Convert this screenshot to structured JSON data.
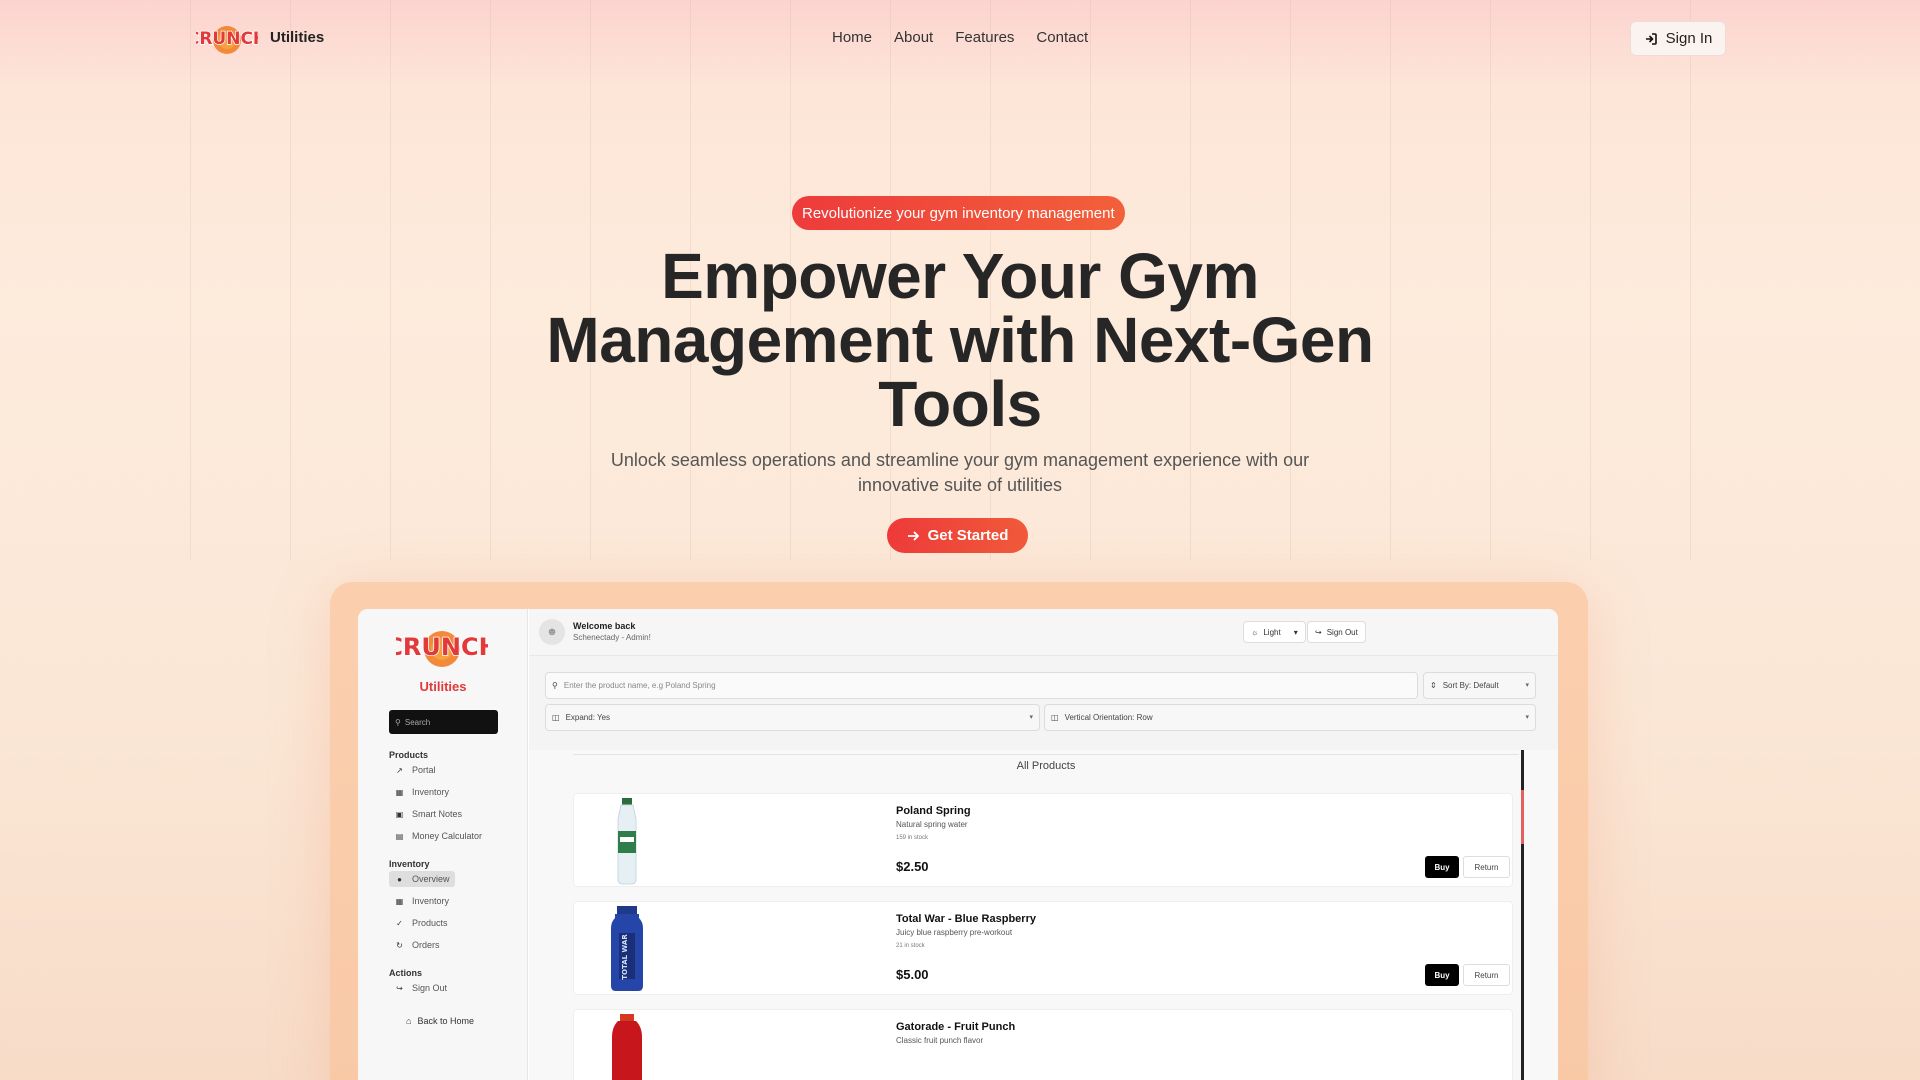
{
  "header": {
    "brand": "Utilities",
    "nav": [
      "Home",
      "About",
      "Features",
      "Contact"
    ],
    "signin_label": "Sign In"
  },
  "hero": {
    "badge": "Revolutionize your gym inventory management",
    "title": "Empower Your Gym Management with Next-Gen Tools",
    "subtitle": "Unlock seamless operations and streamline your gym management experience with our innovative suite of utilities",
    "cta_label": "Get Started"
  },
  "app": {
    "sidebar": {
      "title": "Utilities",
      "search_placeholder": "Search",
      "sections": [
        {
          "label": "Products",
          "items": [
            "Portal",
            "Inventory",
            "Smart Notes",
            "Money Calculator"
          ]
        },
        {
          "label": "Inventory",
          "items": [
            "Overview",
            "Inventory",
            "Products",
            "Orders"
          ]
        },
        {
          "label": "Actions",
          "items": [
            "Sign Out"
          ]
        }
      ],
      "back_label": "Back to Home"
    },
    "topbar": {
      "welcome": "Welcome back",
      "location": "Schenectady - Admin!",
      "theme_label": "Light",
      "signout_label": "Sign Out"
    },
    "filters": {
      "search_placeholder": "Enter the product name, e.g Poland Spring",
      "sort_label": "Sort By: Default",
      "expand_label": "Expand: Yes",
      "orientation_label": "Vertical Orientation: Row"
    },
    "products_title": "All Products",
    "products": [
      {
        "name": "Poland Spring",
        "desc": "Natural spring water",
        "stock": "159 in stock",
        "price": "$2.50",
        "buy": "Buy",
        "return": "Return"
      },
      {
        "name": "Total War - Blue Raspberry",
        "desc": "Juicy blue raspberry pre-workout",
        "stock": "21 in stock",
        "price": "$5.00",
        "buy": "Buy",
        "return": "Return"
      },
      {
        "name": "Gatorade - Fruit Punch",
        "desc": "Classic fruit punch flavor",
        "stock": "",
        "price": "",
        "buy": "",
        "return": ""
      }
    ]
  },
  "colors": {
    "accent": "#ee3b3b",
    "brand_red": "#e2393b"
  },
  "icons": {
    "signin": "sign-in-icon",
    "cta": "arrow-right-icon",
    "search": "search-icon"
  }
}
